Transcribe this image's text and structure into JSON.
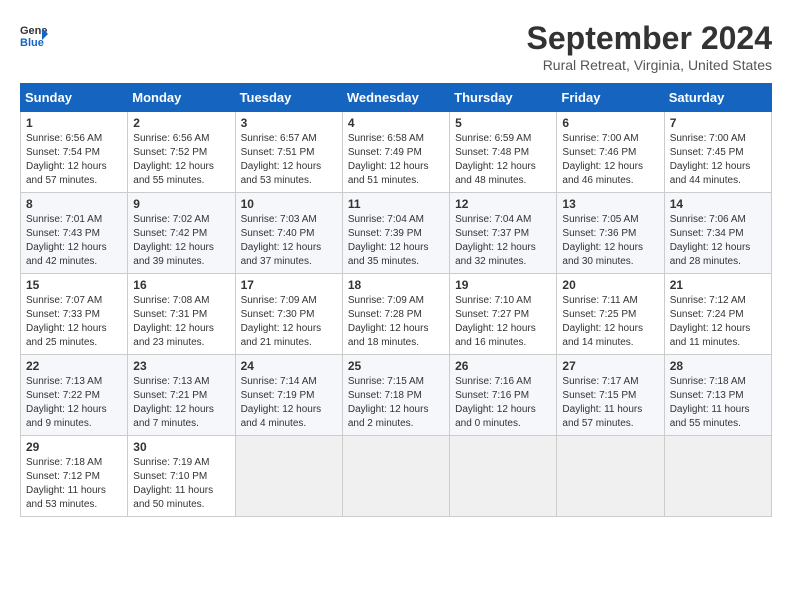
{
  "logo": {
    "text_general": "General",
    "text_blue": "Blue"
  },
  "title": "September 2024",
  "subtitle": "Rural Retreat, Virginia, United States",
  "days_of_week": [
    "Sunday",
    "Monday",
    "Tuesday",
    "Wednesday",
    "Thursday",
    "Friday",
    "Saturday"
  ],
  "weeks": [
    [
      {
        "day": "1",
        "content": "Sunrise: 6:56 AM\nSunset: 7:54 PM\nDaylight: 12 hours and 57 minutes."
      },
      {
        "day": "2",
        "content": "Sunrise: 6:56 AM\nSunset: 7:52 PM\nDaylight: 12 hours and 55 minutes."
      },
      {
        "day": "3",
        "content": "Sunrise: 6:57 AM\nSunset: 7:51 PM\nDaylight: 12 hours and 53 minutes."
      },
      {
        "day": "4",
        "content": "Sunrise: 6:58 AM\nSunset: 7:49 PM\nDaylight: 12 hours and 51 minutes."
      },
      {
        "day": "5",
        "content": "Sunrise: 6:59 AM\nSunset: 7:48 PM\nDaylight: 12 hours and 48 minutes."
      },
      {
        "day": "6",
        "content": "Sunrise: 7:00 AM\nSunset: 7:46 PM\nDaylight: 12 hours and 46 minutes."
      },
      {
        "day": "7",
        "content": "Sunrise: 7:00 AM\nSunset: 7:45 PM\nDaylight: 12 hours and 44 minutes."
      }
    ],
    [
      {
        "day": "8",
        "content": "Sunrise: 7:01 AM\nSunset: 7:43 PM\nDaylight: 12 hours and 42 minutes."
      },
      {
        "day": "9",
        "content": "Sunrise: 7:02 AM\nSunset: 7:42 PM\nDaylight: 12 hours and 39 minutes."
      },
      {
        "day": "10",
        "content": "Sunrise: 7:03 AM\nSunset: 7:40 PM\nDaylight: 12 hours and 37 minutes."
      },
      {
        "day": "11",
        "content": "Sunrise: 7:04 AM\nSunset: 7:39 PM\nDaylight: 12 hours and 35 minutes."
      },
      {
        "day": "12",
        "content": "Sunrise: 7:04 AM\nSunset: 7:37 PM\nDaylight: 12 hours and 32 minutes."
      },
      {
        "day": "13",
        "content": "Sunrise: 7:05 AM\nSunset: 7:36 PM\nDaylight: 12 hours and 30 minutes."
      },
      {
        "day": "14",
        "content": "Sunrise: 7:06 AM\nSunset: 7:34 PM\nDaylight: 12 hours and 28 minutes."
      }
    ],
    [
      {
        "day": "15",
        "content": "Sunrise: 7:07 AM\nSunset: 7:33 PM\nDaylight: 12 hours and 25 minutes."
      },
      {
        "day": "16",
        "content": "Sunrise: 7:08 AM\nSunset: 7:31 PM\nDaylight: 12 hours and 23 minutes."
      },
      {
        "day": "17",
        "content": "Sunrise: 7:09 AM\nSunset: 7:30 PM\nDaylight: 12 hours and 21 minutes."
      },
      {
        "day": "18",
        "content": "Sunrise: 7:09 AM\nSunset: 7:28 PM\nDaylight: 12 hours and 18 minutes."
      },
      {
        "day": "19",
        "content": "Sunrise: 7:10 AM\nSunset: 7:27 PM\nDaylight: 12 hours and 16 minutes."
      },
      {
        "day": "20",
        "content": "Sunrise: 7:11 AM\nSunset: 7:25 PM\nDaylight: 12 hours and 14 minutes."
      },
      {
        "day": "21",
        "content": "Sunrise: 7:12 AM\nSunset: 7:24 PM\nDaylight: 12 hours and 11 minutes."
      }
    ],
    [
      {
        "day": "22",
        "content": "Sunrise: 7:13 AM\nSunset: 7:22 PM\nDaylight: 12 hours and 9 minutes."
      },
      {
        "day": "23",
        "content": "Sunrise: 7:13 AM\nSunset: 7:21 PM\nDaylight: 12 hours and 7 minutes."
      },
      {
        "day": "24",
        "content": "Sunrise: 7:14 AM\nSunset: 7:19 PM\nDaylight: 12 hours and 4 minutes."
      },
      {
        "day": "25",
        "content": "Sunrise: 7:15 AM\nSunset: 7:18 PM\nDaylight: 12 hours and 2 minutes."
      },
      {
        "day": "26",
        "content": "Sunrise: 7:16 AM\nSunset: 7:16 PM\nDaylight: 12 hours and 0 minutes."
      },
      {
        "day": "27",
        "content": "Sunrise: 7:17 AM\nSunset: 7:15 PM\nDaylight: 11 hours and 57 minutes."
      },
      {
        "day": "28",
        "content": "Sunrise: 7:18 AM\nSunset: 7:13 PM\nDaylight: 11 hours and 55 minutes."
      }
    ],
    [
      {
        "day": "29",
        "content": "Sunrise: 7:18 AM\nSunset: 7:12 PM\nDaylight: 11 hours and 53 minutes."
      },
      {
        "day": "30",
        "content": "Sunrise: 7:19 AM\nSunset: 7:10 PM\nDaylight: 11 hours and 50 minutes."
      },
      {
        "day": "",
        "content": ""
      },
      {
        "day": "",
        "content": ""
      },
      {
        "day": "",
        "content": ""
      },
      {
        "day": "",
        "content": ""
      },
      {
        "day": "",
        "content": ""
      }
    ]
  ]
}
